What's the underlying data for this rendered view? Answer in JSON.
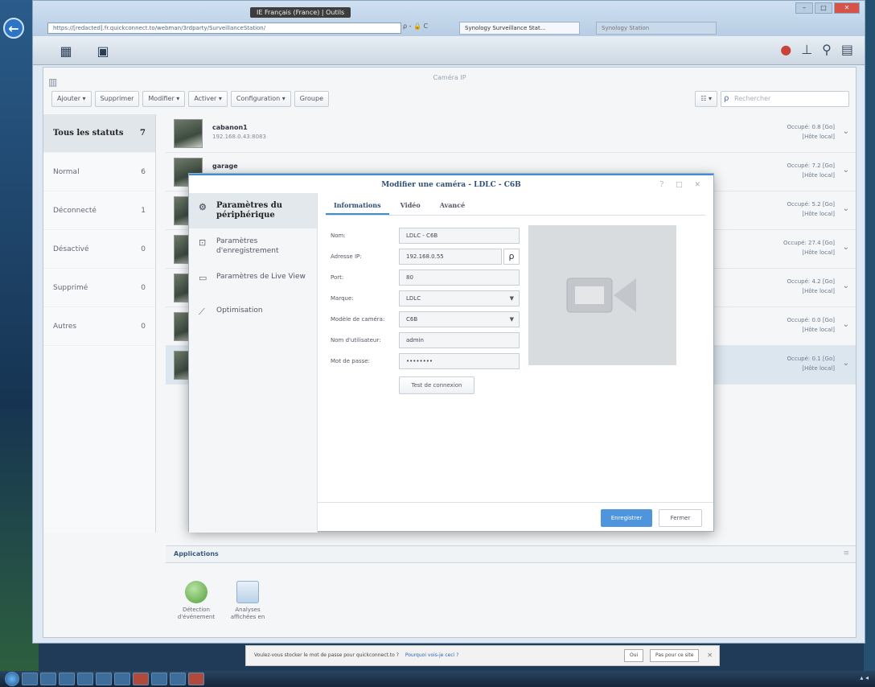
{
  "browser": {
    "ie_tag": "IE Français (France) | Outils",
    "address": "https://[redacted].fr.quickconnect.to/webman/3rdparty/SurveillanceStation/",
    "address_tools": "ρ - 🔒 C",
    "tab_active": "Synology Surveillance Stat...",
    "tab_inactive": "Synology Station"
  },
  "app": {
    "title": "Caméra IP",
    "toolbar": {
      "add": "Ajouter ▾",
      "delete": "Supprimer",
      "edit": "Modifier ▾",
      "enable": "Activer ▾",
      "config": "Configuration ▾",
      "group": "Groupe",
      "view": "☷ ▾",
      "search_placeholder": "Rechercher"
    },
    "status_filters": [
      {
        "label": "Tous les statuts",
        "count": "7"
      },
      {
        "label": "Normal",
        "count": "6"
      },
      {
        "label": "Déconnecté",
        "count": "1"
      },
      {
        "label": "Désactivé",
        "count": "0"
      },
      {
        "label": "Supprimé",
        "count": "0"
      },
      {
        "label": "Autres",
        "count": "0"
      }
    ],
    "cameras": [
      {
        "name": "cabanon1",
        "ip": "192.168.0.43:8083",
        "storage": "Occupé: 0.8 [Go]",
        "host": "[Hôte local]"
      },
      {
        "name": "garage",
        "ip": "",
        "storage": "Occupé: 7.2 [Go]",
        "host": "[Hôte local]"
      },
      {
        "name": "",
        "ip": "",
        "storage": "Occupé: 5.2 [Go]",
        "host": "[Hôte local]"
      },
      {
        "name": "",
        "ip": "",
        "storage": "Occupé: 27.4 [Go]",
        "host": "[Hôte local]"
      },
      {
        "name": "",
        "ip": "",
        "storage": "Occupé: 4.2 [Go]",
        "host": "[Hôte local]"
      },
      {
        "name": "",
        "ip": "",
        "storage": "Occupé: 0.0 [Go]",
        "host": "[Hôte local]"
      },
      {
        "name": "",
        "ip": "",
        "storage": "Occupé: 0.1 [Go]",
        "host": "[Hôte local]"
      }
    ],
    "applications": {
      "title": "Applications",
      "items": [
        "Détection d'événement",
        "Analyses affichées en"
      ]
    }
  },
  "modal": {
    "title": "Modifier une caméra - LDLC - C6B",
    "nav": [
      "Paramètres du périphérique",
      "Paramètres d'enregistrement",
      "Paramètres de Live View",
      "Optimisation"
    ],
    "tabs": [
      "Informations",
      "Vidéo",
      "Avancé"
    ],
    "fields": {
      "name": {
        "label": "Nom:",
        "value": "LDLC - C6B"
      },
      "ip": {
        "label": "Adresse IP:",
        "value": "192.168.0.55"
      },
      "port": {
        "label": "Port:",
        "value": "80"
      },
      "brand": {
        "label": "Marque:",
        "value": "LDLC"
      },
      "model": {
        "label": "Modèle de caméra:",
        "value": "C6B"
      },
      "user": {
        "label": "Nom d'utilisateur:",
        "value": "admin"
      },
      "password": {
        "label": "Mot de passe:",
        "value": "••••••••"
      }
    },
    "test_button": "Test de connexion",
    "save_button": "Enregistrer",
    "close_button": "Fermer"
  },
  "password_bar": {
    "text": "Voulez-vous stocker le mot de passe pour quickconnect.to ?",
    "link": "Pourquoi vois-je ceci ?",
    "yes": "Oui",
    "no": "Pas pour ce site"
  },
  "colors": {
    "accent": "#3c8ed6",
    "save": "#4f95de",
    "notification": "#c9433b"
  }
}
